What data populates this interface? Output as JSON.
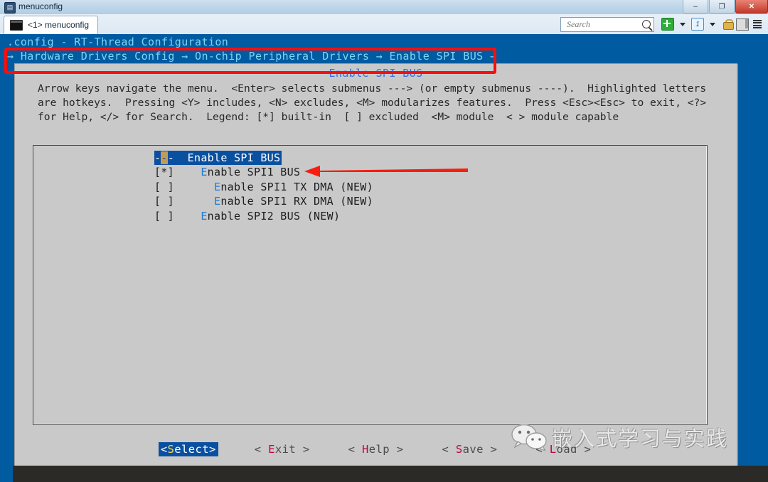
{
  "window": {
    "title": "menuconfig",
    "icon": "terminal-window-icon",
    "minimize_label": "–",
    "maximize_label": "❐",
    "close_label": "✕"
  },
  "tabbar": {
    "tab_label": "<1> menuconfig",
    "search_placeholder": "Search",
    "search_value": "",
    "icons": [
      "plus-icon",
      "dropdown-caret-icon",
      "session-number-icon",
      "dropdown-caret-icon",
      "lock-icon",
      "panel-toggle-icon",
      "hamburger-menu-icon"
    ]
  },
  "terminal": {
    "header": ".config - RT-Thread Configuration",
    "breadcrumb": "→ Hardware Drivers Config → On-chip Peripheral Drivers → Enable SPI BUS →",
    "accent_blue": "#005ba1",
    "cyan_text": "#7fd4f2"
  },
  "dialog": {
    "title": "Enable SPI BUS",
    "title_color": "#3b6fd4",
    "help_lines": [
      "Arrow keys navigate the menu.  <Enter> selects submenus ---> (or empty submenus ----).  Highlighted letters",
      "are hotkeys.  Pressing <Y> includes, <N> excludes, <M> modularizes features.  Press <Esc><Esc> to exit, <?>",
      "for Help, </> for Search.  Legend: [*] built-in  [ ] excluded  <M> module  < > module capable"
    ],
    "menu_items": [
      {
        "marker": "-",
        "hot_marker": "-",
        "marker_tail": "-",
        "prefix": "  ",
        "hotkey": "",
        "label": "Enable SPI BUS",
        "selected": true,
        "indent": 0
      },
      {
        "marker": "[*] ",
        "prefix": "   ",
        "hotkey": "E",
        "label": "nable SPI1 BUS",
        "selected": false,
        "indent": 0
      },
      {
        "marker": "[ ] ",
        "prefix": "     ",
        "hotkey": "E",
        "label": "nable SPI1 TX DMA (NEW)",
        "selected": false,
        "indent": 1
      },
      {
        "marker": "[ ] ",
        "prefix": "     ",
        "hotkey": "E",
        "label": "nable SPI1 RX DMA (NEW)",
        "selected": false,
        "indent": 1
      },
      {
        "marker": "[ ] ",
        "prefix": "   ",
        "hotkey": "E",
        "label": "nable SPI2 BUS (NEW)",
        "selected": false,
        "indent": 0
      }
    ],
    "buttons": [
      {
        "pre": "<",
        "key": "S",
        "post": "elect>",
        "selected": true,
        "name": "select-button"
      },
      {
        "pre": "< ",
        "key": "E",
        "post": "xit >",
        "selected": false,
        "name": "exit-button"
      },
      {
        "pre": "< ",
        "key": "H",
        "post": "elp >",
        "selected": false,
        "name": "help-button"
      },
      {
        "pre": "< ",
        "key": "S",
        "post": "ave >",
        "selected": false,
        "name": "save-button"
      },
      {
        "pre": "< ",
        "key": "L",
        "post": "oad >",
        "selected": false,
        "name": "load-button"
      }
    ]
  },
  "annotations": {
    "rect_color": "#fb0d0d",
    "arrow_color": "#f81d0e",
    "rect_target": "breadcrumb",
    "arrow_target": "Enable SPI1 BUS"
  },
  "watermark": {
    "logo": "wechat-logo",
    "text": "嵌入式学习与实践"
  }
}
